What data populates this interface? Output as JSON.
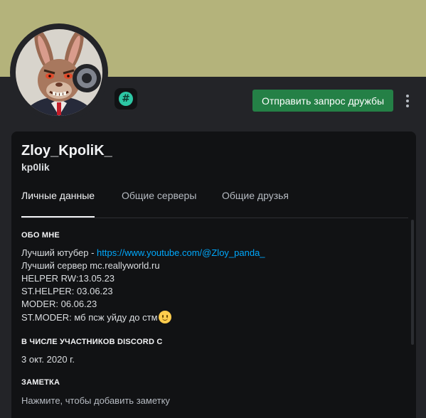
{
  "colors": {
    "banner": "#b4b37b",
    "background": "#232428",
    "card": "#111214",
    "accent_button": "#248046",
    "link": "#00a8fc",
    "status_offline": "#80848e",
    "badge": "#2dc7a5"
  },
  "header": {
    "avatar_icon": "rabbit-avatar",
    "status": "offline",
    "badge_icon": "hashtag-badge-icon",
    "badge_symbol": "#",
    "friend_request_label": "Отправить запрос дружбы",
    "more_icon": "vertical-ellipsis-icon"
  },
  "profile": {
    "display_name": "Zloy_KpoliK_",
    "username": "kp0lik"
  },
  "tabs": [
    {
      "label": "Личные данные",
      "active": true
    },
    {
      "label": "Общие серверы",
      "active": false
    },
    {
      "label": "Общие друзья",
      "active": false
    }
  ],
  "about": {
    "title": "ОБО МНЕ",
    "line1_prefix": "Лучший ютубер - ",
    "line1_link": "https://www.youtube.com/@Zloy_panda_",
    "line2": "Лучший сервер mc.reallyworld.ru",
    "line3": "HELPER RW:13.05.23",
    "line4": "ST.HELPER: 03.06.23",
    "line5": "MODER: 06.06.23",
    "line6": "ST.MODER: мб псж уйду до стм",
    "emoji_icon": "slightly-smiling-face-emoji"
  },
  "member_since": {
    "title": "В ЧИСЛЕ УЧАСТНИКОВ DISCORD С",
    "date": "3 окт. 2020 г."
  },
  "note": {
    "title": "ЗАМЕТКА",
    "placeholder": "Нажмите, чтобы добавить заметку"
  }
}
